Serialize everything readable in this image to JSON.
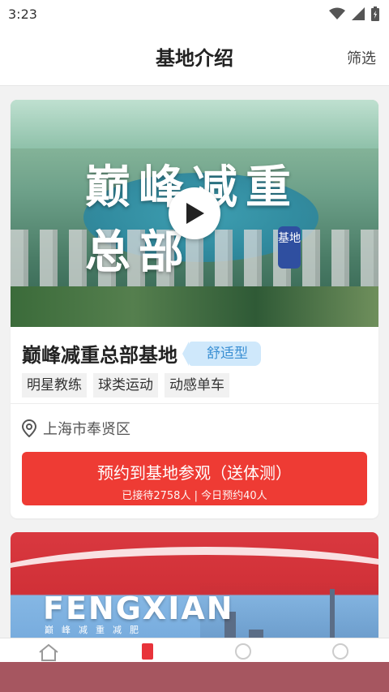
{
  "status": {
    "time": "3:23"
  },
  "header": {
    "title": "基地介绍",
    "filter_label": "筛选"
  },
  "cards": [
    {
      "hero_text": "巅峰减重总部",
      "hero_stamp": "基地",
      "name": "巅峰减重总部基地",
      "type_tag": "舒适型",
      "features": [
        "明星教练",
        "球类运动",
        "动感单车"
      ],
      "location": "上海市奉贤区",
      "book_label": "预约到基地参观（送体测）",
      "book_sub": "已接待2758人 | 今日预约40人"
    },
    {
      "hero_text": "FENGXIAN",
      "hero_sub": "巅峰减重减肥"
    }
  ],
  "colors": {
    "accent_red": "#ee3b34",
    "tag_blue": "#3a8fd3",
    "tag_bg": "#cfe8fb"
  },
  "icons": [
    "wifi-icon",
    "signal-icon",
    "battery-icon",
    "play-icon",
    "location-pin-icon",
    "home-icon"
  ]
}
